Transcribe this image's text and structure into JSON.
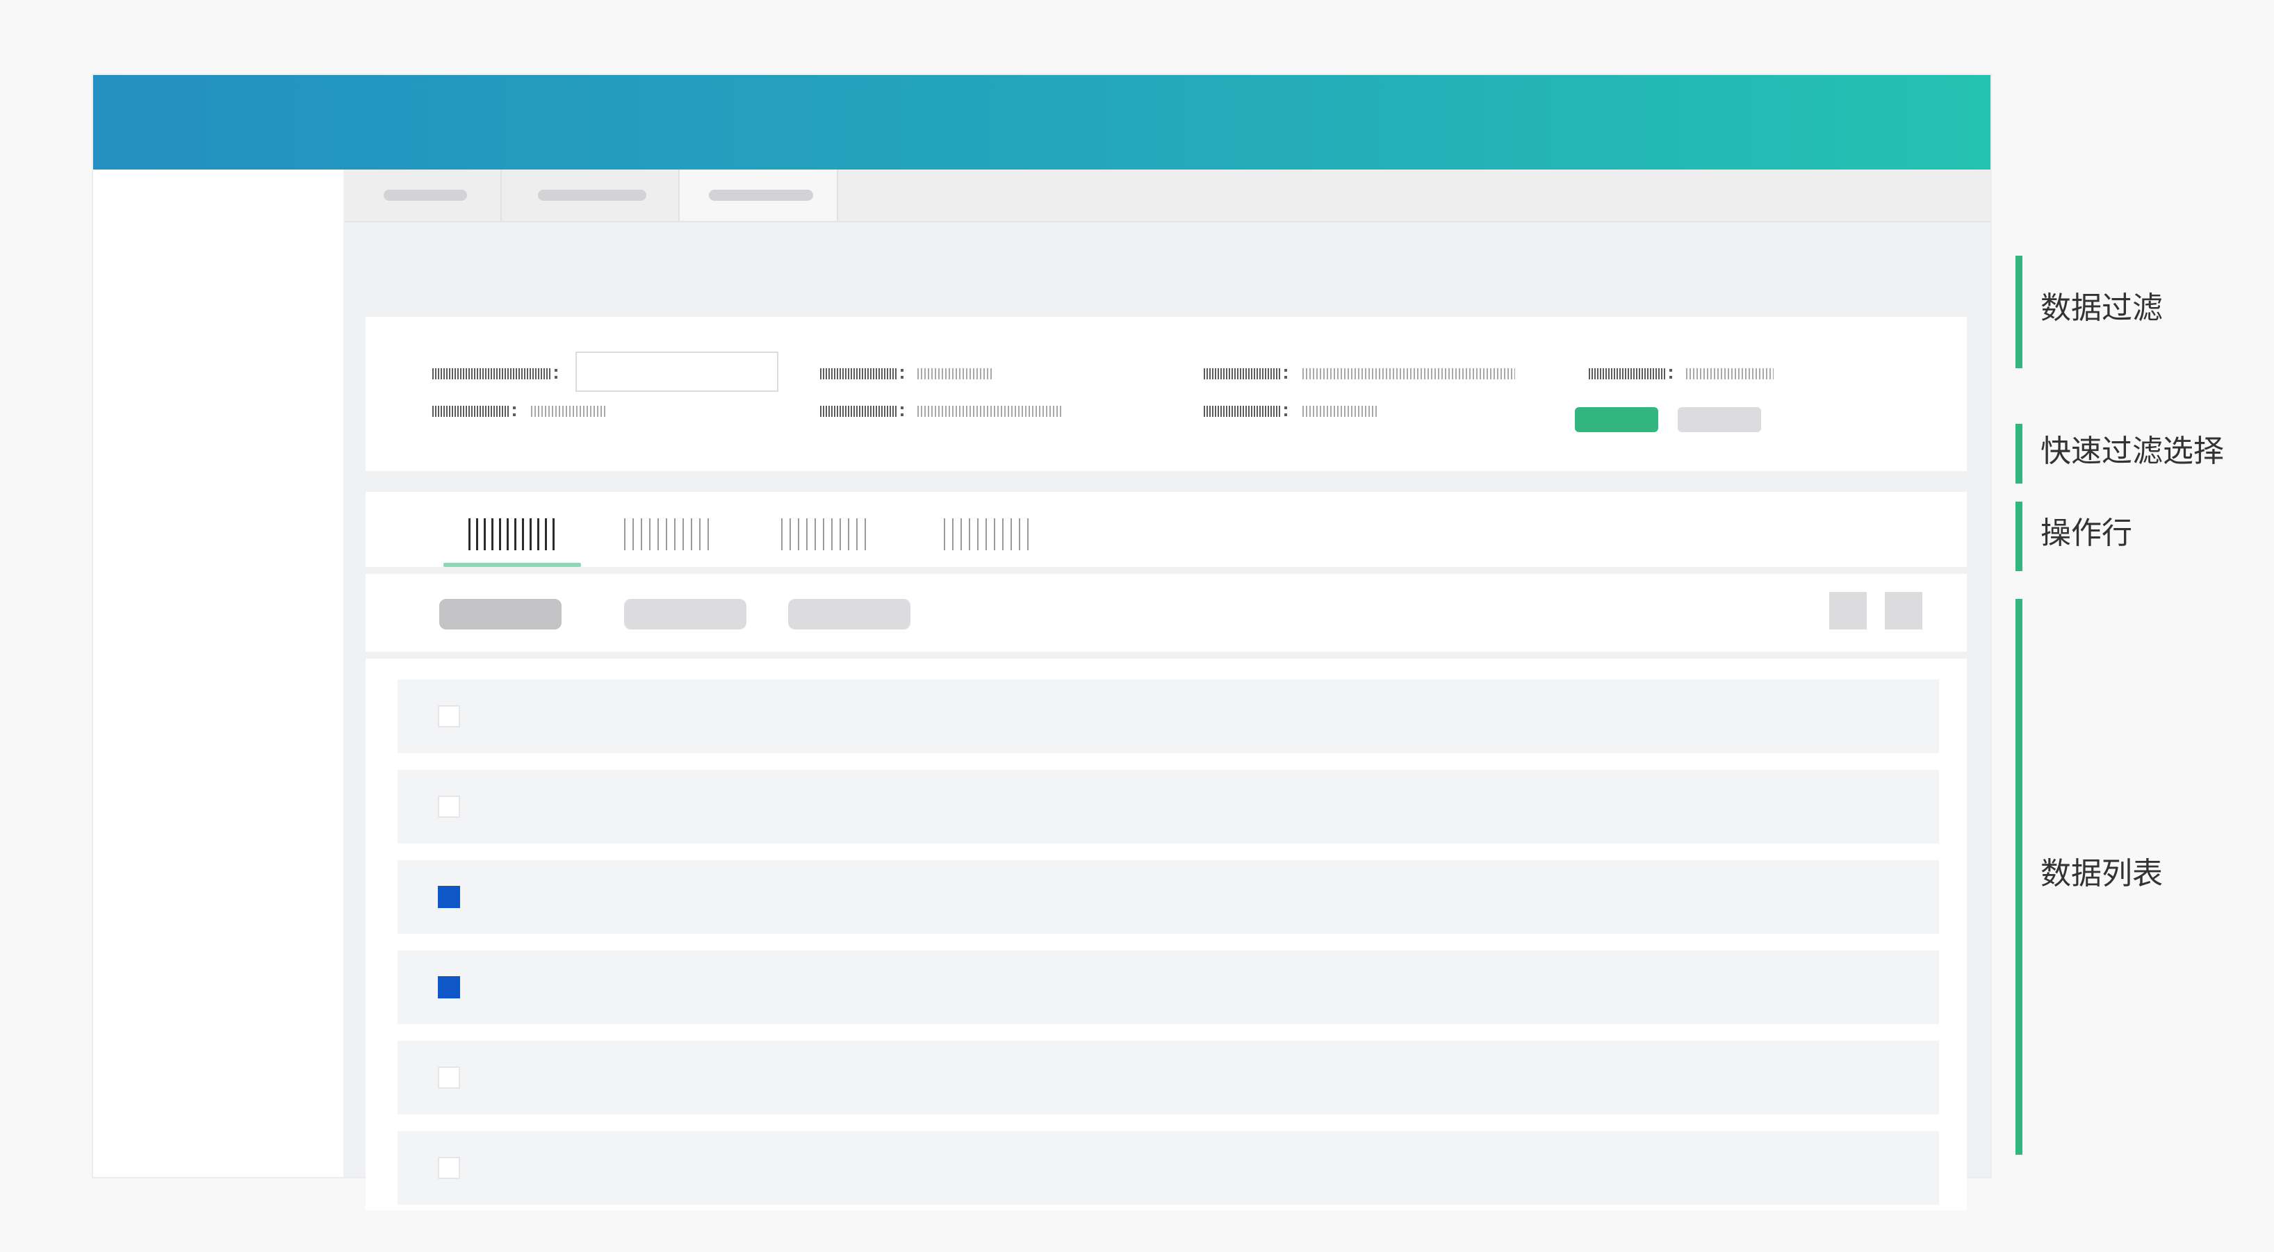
{
  "app": {
    "header_gradient": [
      "#2390c1",
      "#24c2b1"
    ]
  },
  "page_tabs": [
    {
      "active": false
    },
    {
      "active": false
    },
    {
      "active": true
    }
  ],
  "filter": {
    "reset_button_color": "#dcdcde",
    "search_button_color": "#33b57f"
  },
  "quick_filter": {
    "active_index": 0,
    "underline_color": "#8fd6b6"
  },
  "data_list": {
    "rows": [
      {
        "checked": false
      },
      {
        "checked": false
      },
      {
        "checked": true
      },
      {
        "checked": true
      },
      {
        "checked": false
      },
      {
        "checked": false
      }
    ],
    "checked_color": "#0f57c8"
  },
  "annotations": [
    {
      "label": "数据过滤",
      "color": "#33b57f"
    },
    {
      "label": "快速过滤选择",
      "color": "#33b57f"
    },
    {
      "label": "操作行",
      "color": "#33b57f"
    },
    {
      "label": "数据列表",
      "color": "#33b57f"
    }
  ]
}
